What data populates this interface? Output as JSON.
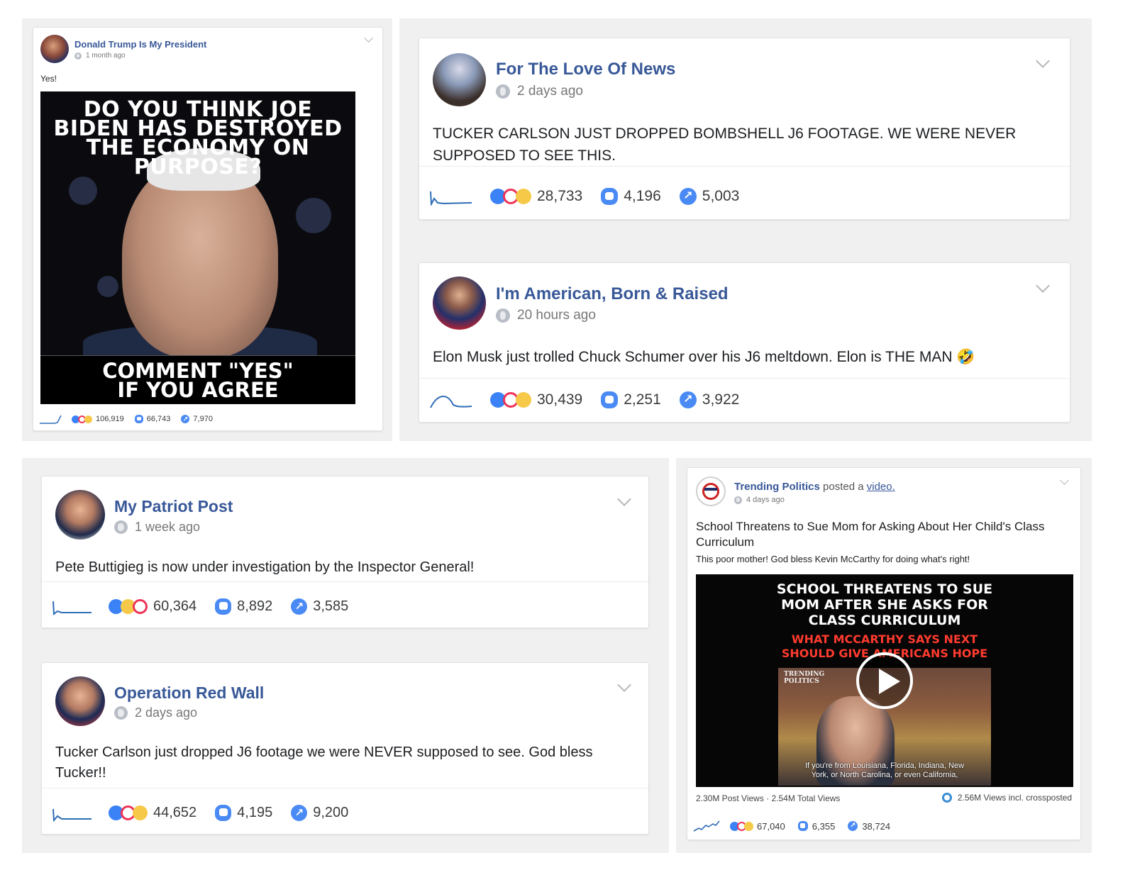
{
  "posts": {
    "p1": {
      "page_name": "Donald Trump Is My President",
      "time": "1 month ago",
      "text": "Yes!",
      "meme": {
        "headline": "DO YOU THINK JOE BIDEN HAS DESTROYED THE ECONOMY ON PURPOSE?",
        "cta_line1": "COMMENT \"YES\"",
        "cta_line2": "IF YOU AGREE"
      },
      "reactions": "106,919",
      "comments": "66,743",
      "shares": "7,970"
    },
    "p2": {
      "page_name": "For The Love Of News",
      "time": "2 days ago",
      "text": "TUCKER CARLSON JUST DROPPED BOMBSHELL J6 FOOTAGE. WE WERE NEVER SUPPOSED TO SEE THIS.",
      "reactions": "28,733",
      "comments": "4,196",
      "shares": "5,003"
    },
    "p3": {
      "page_name": "I'm American, Born & Raised",
      "time": "20 hours ago",
      "text": "Elon Musk just trolled Chuck Schumer over his J6 meltdown. Elon is THE MAN 🤣",
      "reactions": "30,439",
      "comments": "2,251",
      "shares": "3,922"
    },
    "p4": {
      "page_name": "My Patriot Post",
      "time": "1 week ago",
      "text": "Pete Buttigieg is now under investigation by the Inspector General!",
      "reactions": "60,364",
      "comments": "8,892",
      "shares": "3,585"
    },
    "p5": {
      "page_name": "Operation Red Wall",
      "time": "2 days ago",
      "text": "Tucker Carlson just dropped J6 footage we were NEVER supposed to see. God bless Tucker!!",
      "reactions": "44,652",
      "comments": "4,195",
      "shares": "9,200"
    },
    "p6": {
      "page_name": "Trending Politics",
      "posted_a": "posted a",
      "video_link": "video.",
      "time": "4 days ago",
      "title": "School Threatens to Sue Mom for Asking About Her Child's Class Curriculum",
      "text": "This poor mother! God bless Kevin McCarthy for doing what's right!",
      "video": {
        "headline1": "SCHOOL THREATENS TO SUE",
        "headline2": "MOM AFTER SHE ASKS FOR",
        "headline3": "CLASS CURRICULUM",
        "sub1": "WHAT MCCARTHY SAYS NEXT",
        "sub2": "SHOULD GIVE AMERICANS HOPE",
        "brand1": "TRENDING",
        "brand2": "POLITICS",
        "caption1": "If you're from Louisiana, Florida, Indiana, New",
        "caption2": "York, or North Carolina, or even California,"
      },
      "views_left": "2.30M Post Views · 2.54M Total Views",
      "views_right": "2.56M Views incl. crossposted",
      "reactions": "67,040",
      "comments": "6,355",
      "shares": "38,724"
    }
  },
  "colors": {
    "page_name": "#385898",
    "like": "#3b82f6",
    "love": "#ee3355",
    "haha": "#f7c948",
    "spark": "#2f6db5"
  }
}
